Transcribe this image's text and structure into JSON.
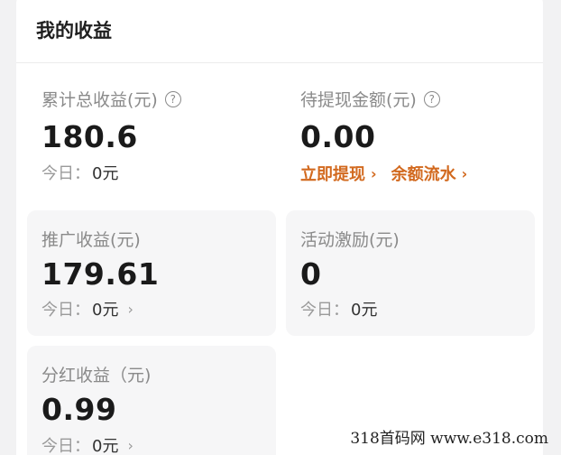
{
  "header": {
    "title": "我的收益"
  },
  "help_icon_glyph": "?",
  "chevron_glyph": "›",
  "stats": {
    "total": {
      "label": "累计总收益(元)",
      "value": "180.6",
      "today_label": "今日：",
      "today_value": "0元"
    },
    "withdrawable": {
      "label": "待提现金额(元)",
      "value": "0.00",
      "links": {
        "withdraw": "立即提现",
        "flow": "余额流水"
      }
    },
    "promotion": {
      "label": "推广收益(元)",
      "value": "179.61",
      "today_label": "今日：",
      "today_value": "0元"
    },
    "activity": {
      "label": "活动激励(元)",
      "value": "0",
      "today_label": "今日：",
      "today_value": "0元"
    },
    "dividend": {
      "label": "分红收益（元)",
      "value": "0.99",
      "today_label": "今日：",
      "today_value": "0元"
    }
  },
  "watermark": "318首码网  www.e318.com",
  "colors": {
    "accent": "#d2691e",
    "tile_bg": "#f6f6f7",
    "page_bg": "#f2f2f3"
  }
}
